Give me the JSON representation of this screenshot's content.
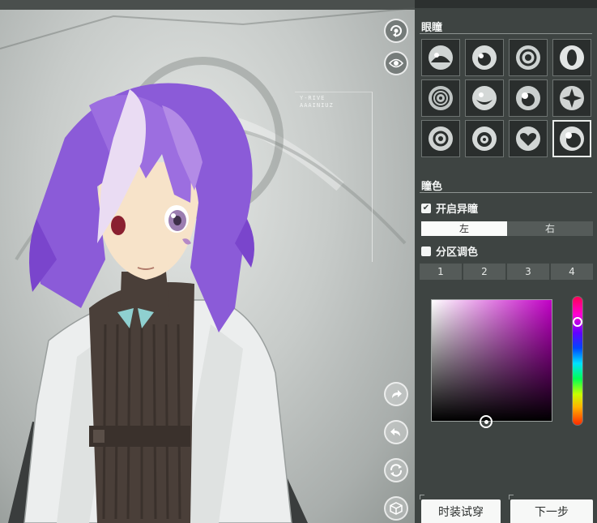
{
  "viewport": {
    "hud_lines": [
      "Y-RIVE",
      "AAAINIUZ"
    ],
    "buttons": [
      {
        "name": "rotate-view-button",
        "icon": "rotate-icon"
      },
      {
        "name": "eye-view-button",
        "icon": "eye-icon"
      },
      {
        "name": "redo-button",
        "icon": "redo-arrow-icon"
      },
      {
        "name": "undo-button",
        "icon": "undo-arrow-icon"
      },
      {
        "name": "reset-button",
        "icon": "reset-icon"
      },
      {
        "name": "random-button",
        "icon": "cube-icon"
      }
    ]
  },
  "panel": {
    "eye_section_title": "眼瞳",
    "eye_styles": [
      {
        "id": 1,
        "selected": false
      },
      {
        "id": 2,
        "selected": false
      },
      {
        "id": 3,
        "selected": false
      },
      {
        "id": 4,
        "selected": false
      },
      {
        "id": 5,
        "selected": false
      },
      {
        "id": 6,
        "selected": false
      },
      {
        "id": 7,
        "selected": false
      },
      {
        "id": 8,
        "selected": false
      },
      {
        "id": 9,
        "selected": false
      },
      {
        "id": 10,
        "selected": false
      },
      {
        "id": 11,
        "selected": false
      },
      {
        "id": 12,
        "selected": true
      }
    ],
    "color_section_title": "瞳色",
    "heterochromia": {
      "label": "开启异瞳",
      "checked": true
    },
    "side_tabs": [
      {
        "label": "左",
        "active": true
      },
      {
        "label": "右",
        "active": false
      }
    ],
    "zone_color": {
      "label": "分区调色",
      "checked": false
    },
    "zone_tabs": [
      "1",
      "2",
      "3",
      "4"
    ],
    "picker": {
      "hue_color": "#c200c6"
    },
    "buttons": {
      "try_on": "时装试穿",
      "next": "下一步"
    }
  }
}
